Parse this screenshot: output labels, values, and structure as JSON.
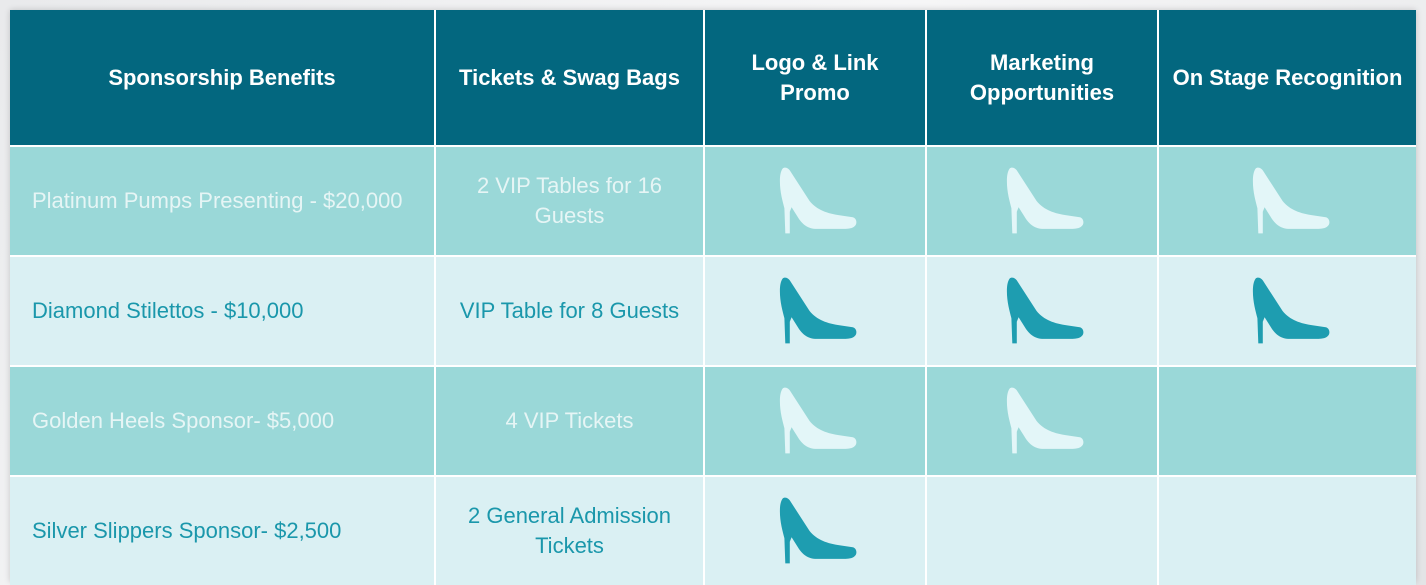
{
  "table": {
    "headers": [
      "Sponsorship Benefits",
      "Tickets & Swag Bags",
      "Logo & Link Promo",
      "Marketing Opportunities",
      "On  Stage Recognition"
    ],
    "rows": [
      {
        "tier": "Platinum Pumps Presenting - $20,000",
        "tickets": "2 VIP Tables for 16 Guests",
        "logo_link": true,
        "marketing": true,
        "on_stage": true
      },
      {
        "tier": "Diamond Stilettos - $10,000",
        "tickets": "VIP Table for 8 Guests",
        "logo_link": true,
        "marketing": true,
        "on_stage": true
      },
      {
        "tier": "Golden Heels Sponsor- $5,000",
        "tickets": "4 VIP Tickets",
        "logo_link": true,
        "marketing": true,
        "on_stage": false
      },
      {
        "tier": "Silver Slippers Sponsor- $2,500",
        "tickets": "2 General Admission Tickets",
        "logo_link": true,
        "marketing": false,
        "on_stage": false
      }
    ]
  },
  "icons": {
    "included_marker": "high-heel-shoe-icon"
  },
  "colors": {
    "header_bg": "#03677f",
    "row_dark_bg": "#9ad8d8",
    "row_light_bg": "#daf0f3",
    "text_light_row": "#1a97ab",
    "text_dark_row": "#e6f5f5"
  }
}
